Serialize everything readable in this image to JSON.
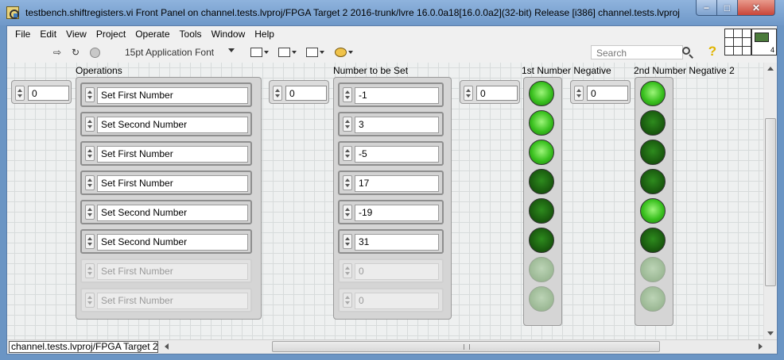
{
  "window": {
    "title": "testbench.shiftregisters.vi Front Panel on channel.tests.lvproj/FPGA Target 2  2016-trunk/lvre   16.0.0a18[16.0.0a2](32-bit)  Release  [i386] channel.tests.lvproj",
    "minimize_glyph": "−",
    "maximize_glyph": "□",
    "close_glyph": "✕"
  },
  "menubar": {
    "items": [
      "File",
      "Edit",
      "View",
      "Project",
      "Operate",
      "Tools",
      "Window",
      "Help"
    ]
  },
  "toolbar": {
    "icons": [
      "run-arrow-icon",
      "run-continuous-icon",
      "abort-icon",
      "align-tool-icon",
      "distribute-tool-icon",
      "resize-tool-icon",
      "reorder-tool-icon"
    ],
    "run_glyph": "⇨",
    "run_continuous_glyph": "↻",
    "font": "15pt Application Font",
    "search_placeholder": "Search",
    "help_glyph": "?",
    "vi_icon_badge": "4"
  },
  "panel": {
    "operations": {
      "label": "Operations",
      "index": "0",
      "items": [
        {
          "text": "Set First Number",
          "enabled": true
        },
        {
          "text": "Set Second Number",
          "enabled": true
        },
        {
          "text": "Set First Number",
          "enabled": true
        },
        {
          "text": "Set First Number",
          "enabled": true
        },
        {
          "text": "Set Second Number",
          "enabled": true
        },
        {
          "text": "Set Second Number",
          "enabled": true
        },
        {
          "text": "Set First Number",
          "enabled": false
        },
        {
          "text": "Set First Number",
          "enabled": false
        }
      ]
    },
    "numbers": {
      "label": "Number to be Set",
      "index": "0",
      "items": [
        {
          "text": "-1",
          "enabled": true
        },
        {
          "text": "3",
          "enabled": true
        },
        {
          "text": "-5",
          "enabled": true
        },
        {
          "text": "17",
          "enabled": true
        },
        {
          "text": "-19",
          "enabled": true
        },
        {
          "text": "31",
          "enabled": true
        },
        {
          "text": "0",
          "enabled": false
        },
        {
          "text": "0",
          "enabled": false
        }
      ]
    },
    "first_negative": {
      "label": "1st Number Negative",
      "index": "0",
      "leds": [
        "on",
        "on",
        "on",
        "off",
        "off",
        "off",
        "disabled",
        "disabled"
      ]
    },
    "second_negative": {
      "label": "2nd Number Negative 2",
      "index": "0",
      "leds": [
        "on",
        "off",
        "off",
        "off",
        "on",
        "off",
        "disabled",
        "disabled"
      ]
    }
  },
  "statusbar": {
    "target": "channel.tests.lvproj/FPGA Target 2"
  },
  "colors": {
    "led_on": "#39c01e",
    "led_off": "#1a5c0f",
    "canvas_grid": "#d7dbdb",
    "title_bar": "#8fb3dd"
  }
}
